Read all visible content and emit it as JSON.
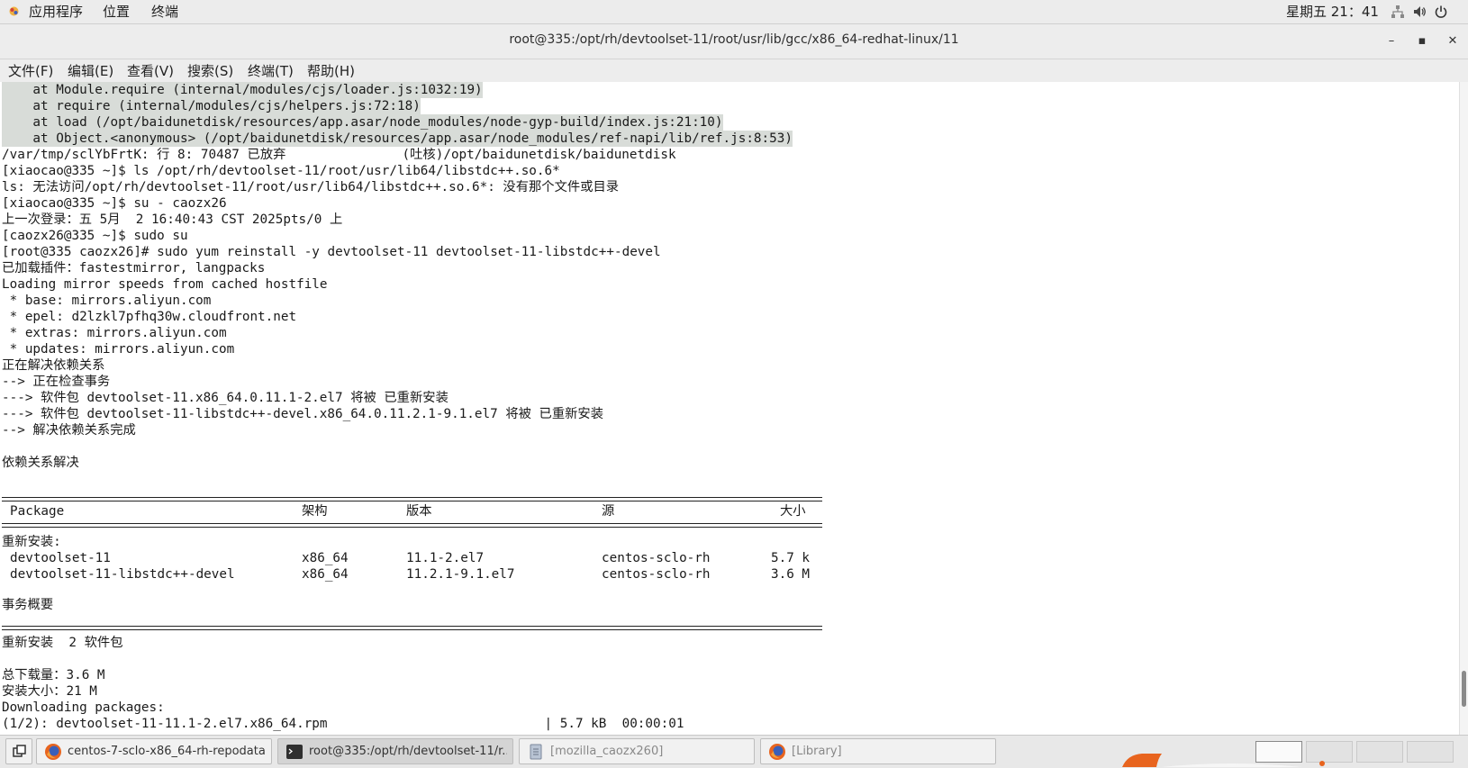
{
  "top_panel": {
    "apps": "应用程序",
    "places": "位置",
    "terminal": "终端",
    "clock": "星期五 21：41"
  },
  "window": {
    "title": "root@335:/opt/rh/devtoolset-11/root/usr/lib/gcc/x86_64-redhat-linux/11",
    "minimize": "–",
    "maximize": "▪",
    "close": "✕"
  },
  "menu": {
    "file": "文件(F)",
    "edit": "编辑(E)",
    "view": "查看(V)",
    "search": "搜索(S)",
    "terminal": "终端(T)",
    "help": "帮助(H)"
  },
  "terminal": {
    "lines": [
      "    at Module.require (internal/modules/cjs/loader.js:1032:19)",
      "    at require (internal/modules/cjs/helpers.js:72:18)",
      "    at load (/opt/baidunetdisk/resources/app.asar/node_modules/node-gyp-build/index.js:21:10)",
      "    at Object.<anonymous> (/opt/baidunetdisk/resources/app.asar/node_modules/ref-napi/lib/ref.js:8:53)",
      "/var/tmp/sclYbFrtK: 行 8: 70487 已放弃               (吐核)/opt/baidunetdisk/baidunetdisk",
      "[xiaocao@335 ~]$ ls /opt/rh/devtoolset-11/root/usr/lib64/libstdc++.so.6*",
      "ls: 无法访问/opt/rh/devtoolset-11/root/usr/lib64/libstdc++.so.6*: 没有那个文件或目录",
      "[xiaocao@335 ~]$ su - caozx26",
      "上一次登录：五 5月  2 16:40:43 CST 2025pts/0 上",
      "[caozx26@335 ~]$ sudo su",
      "[root@335 caozx26]# sudo yum reinstall -y devtoolset-11 devtoolset-11-libstdc++-devel",
      "已加载插件：fastestmirror, langpacks",
      "Loading mirror speeds from cached hostfile",
      " * base: mirrors.aliyun.com",
      " * epel: d2lzkl7pfhq30w.cloudfront.net",
      " * extras: mirrors.aliyun.com",
      " * updates: mirrors.aliyun.com",
      "正在解决依赖关系",
      "--> 正在检查事务",
      "---> 软件包 devtoolset-11.x86_64.0.11.1-2.el7 将被 已重新安装",
      "---> 软件包 devtoolset-11-libstdc++-devel.x86_64.0.11.2.1-9.1.el7 将被 已重新安装",
      "--> 解决依赖关系完成",
      "",
      "依赖关系解决"
    ],
    "table": {
      "headers": [
        "Package",
        "架构",
        "版本",
        "源",
        "大小"
      ],
      "section": "重新安装:",
      "rows": [
        [
          "devtoolset-11",
          "x86_64",
          "11.1-2.el7",
          "centos-sclo-rh",
          "5.7 k"
        ],
        [
          "devtoolset-11-libstdc++-devel",
          "x86_64",
          "11.2.1-9.1.el7",
          "centos-sclo-rh",
          "3.6 M"
        ]
      ]
    },
    "summary_title": "事务概要",
    "summary_line": "重新安装  2 软件包",
    "total_download": "总下载量：3.6 M",
    "install_size": "安装大小：21 M",
    "downloading": "Downloading packages:",
    "progress_line": "(1/2): devtoolset-11-11.1-2.el7.x86_64.rpm                            | 5.7 kB  00:00:01"
  },
  "taskbar": {
    "tasks": [
      {
        "label": "centos-7-sclo-x86_64-rh-repodata...",
        "icon": "firefox-icon"
      },
      {
        "label": "root@335:/opt/rh/devtoolset-11/r...",
        "icon": "terminal-icon"
      },
      {
        "label": "[mozilla_caozx260]",
        "icon": "file-manager-icon"
      },
      {
        "label": "[Library]",
        "icon": "firefox-icon"
      }
    ]
  },
  "colors": {
    "selection_highlight": "#d8dcd8",
    "panel_bg": "#ececec",
    "terminal_fg": "#1a1a1a",
    "firefox_orange": "#e8641e"
  }
}
